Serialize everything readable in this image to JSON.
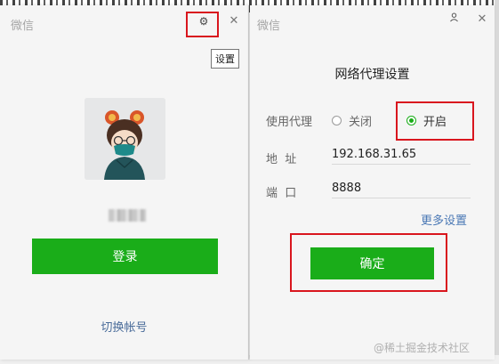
{
  "login_window": {
    "title": "微信",
    "settings_tooltip": "设置",
    "login_button": "登录",
    "switch_account": "切换帐号",
    "icons": {
      "settings": "gear-icon",
      "close": "close-icon"
    }
  },
  "proxy_window": {
    "title": "微信",
    "heading": "网络代理设置",
    "use_proxy_label": "使用代理",
    "option_off": "关闭",
    "option_on": "开启",
    "selected_option": "开启",
    "address_label": "地  址",
    "address_value": "192.168.31.65",
    "port_label": "端  口",
    "port_value": "8888",
    "more_settings": "更多设置",
    "confirm_button": "确定",
    "icons": {
      "user": "user-icon",
      "close": "close-icon"
    }
  },
  "watermark": "@稀土掘金技术社区",
  "colors": {
    "accent_green": "#1aad19",
    "highlight_red": "#d9161e",
    "link_blue": "#4a78b5"
  }
}
